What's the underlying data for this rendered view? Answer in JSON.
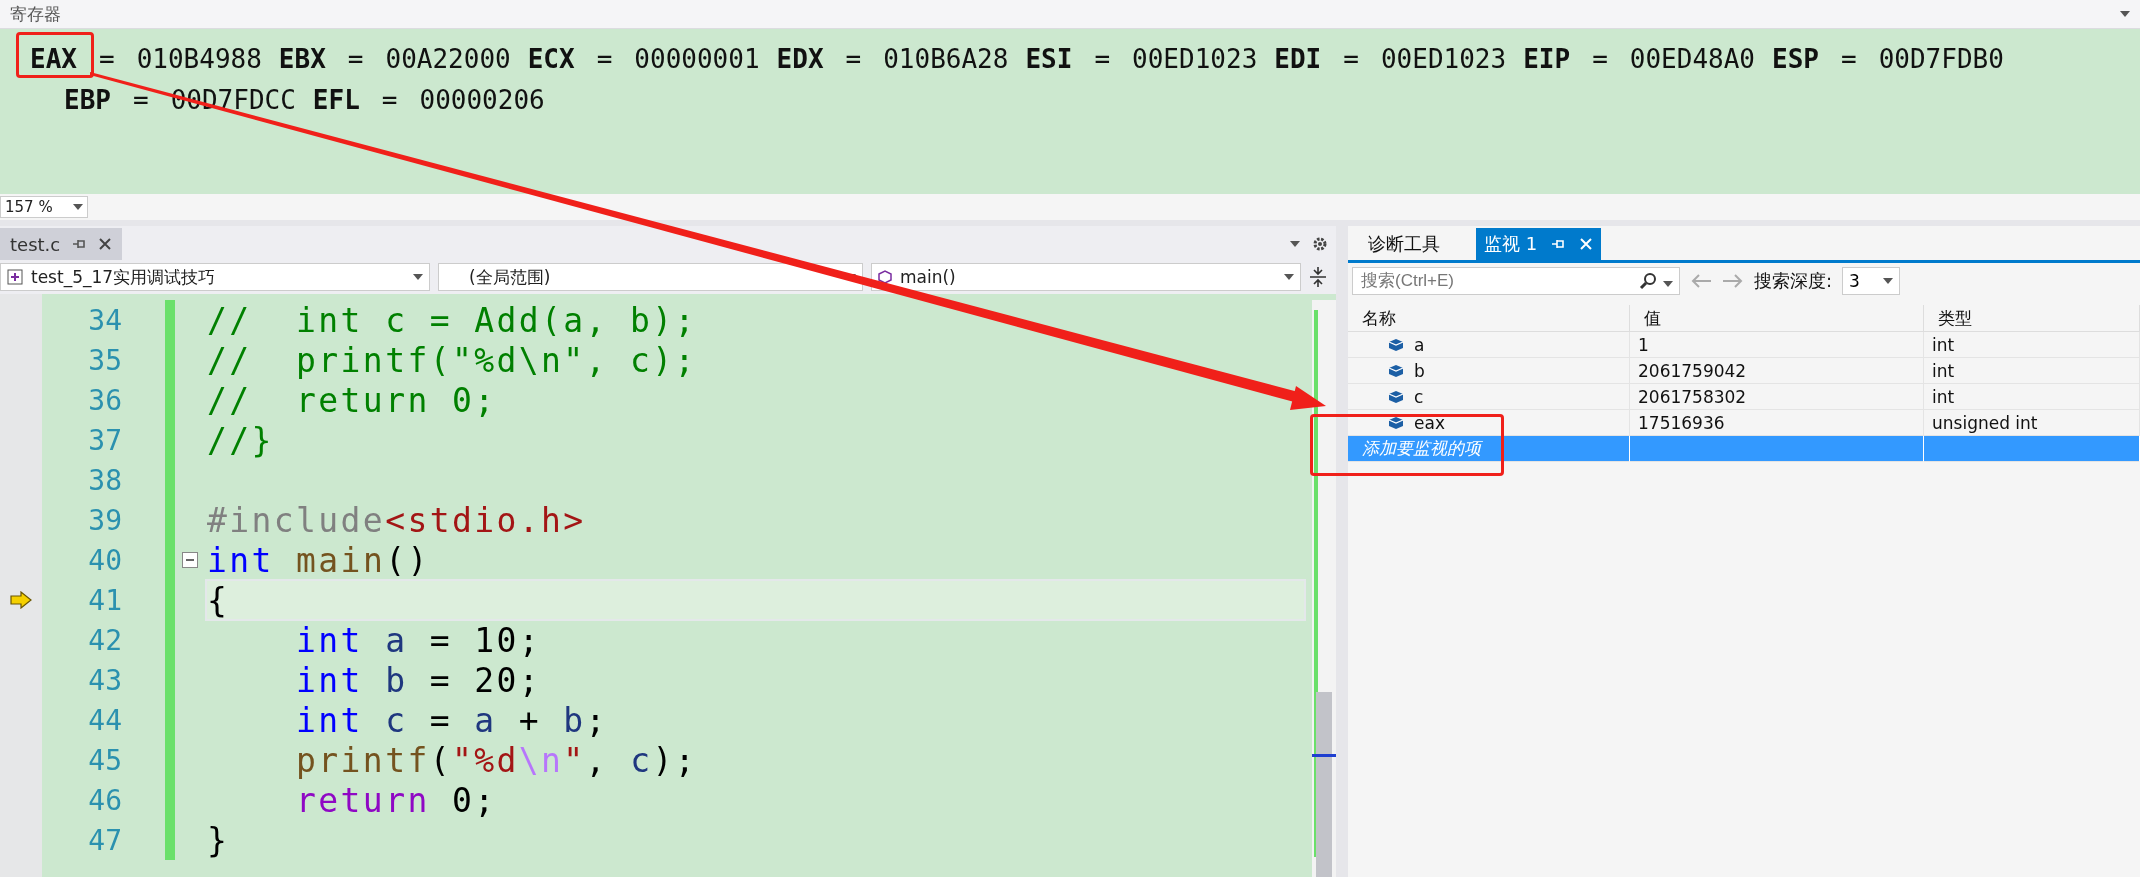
{
  "registers": {
    "title": "寄存器",
    "lines": [
      [
        {
          "name": "EAX",
          "sep": "=",
          "value": "010B4988"
        },
        {
          "name": "EBX",
          "sep": "=",
          "value": "00A22000"
        },
        {
          "name": "ECX",
          "sep": "=",
          "value": "00000001"
        },
        {
          "name": "EDX",
          "sep": "=",
          "value": "010B6A28"
        },
        {
          "name": "ESI",
          "sep": "=",
          "value": "00ED1023"
        },
        {
          "name": "EDI",
          "sep": "=",
          "value": "00ED1023"
        },
        {
          "name": "EIP",
          "sep": "=",
          "value": "00ED48A0"
        },
        {
          "name": "ESP",
          "sep": "=",
          "value": "00D7FDB0"
        }
      ],
      [
        {
          "name": "EBP",
          "sep": "=",
          "value": "00D7FDCC"
        },
        {
          "name": "EFL",
          "sep": "=",
          "value": "00000206"
        }
      ]
    ],
    "zoom": "157 %"
  },
  "editor": {
    "tab": "test.c",
    "project": "test_5_17实用调试技巧",
    "scope": "(全局范围)",
    "function": "main()",
    "lines": [
      {
        "number": "34",
        "current": false,
        "fold": false,
        "tokens": [
          {
            "kind": "comment",
            "text": "//  int c = Add(a, b);"
          }
        ]
      },
      {
        "number": "35",
        "current": false,
        "fold": false,
        "tokens": [
          {
            "kind": "comment",
            "text": "//  printf(\"%d\\n\", c);"
          }
        ]
      },
      {
        "number": "36",
        "current": false,
        "fold": false,
        "tokens": [
          {
            "kind": "comment",
            "text": "//  return 0;"
          }
        ]
      },
      {
        "number": "37",
        "current": false,
        "fold": false,
        "tokens": [
          {
            "kind": "comment",
            "text": "//}"
          }
        ]
      },
      {
        "number": "38",
        "current": false,
        "fold": false
      },
      {
        "number": "39",
        "current": false,
        "fold": false,
        "tokens": [
          {
            "kind": "preproc",
            "text": "#include"
          },
          {
            "kind": "string",
            "text": "<stdio.h>"
          }
        ]
      },
      {
        "number": "40",
        "current": false,
        "fold": true,
        "tokens": [
          {
            "kind": "keyword",
            "text": "int"
          },
          {
            "kind": "func",
            "text": " main"
          },
          {
            "kind": "plain",
            "text": "()"
          }
        ]
      },
      {
        "number": "41",
        "current": true,
        "fold": false,
        "tokens": [
          {
            "kind": "plain",
            "text": "{"
          }
        ]
      },
      {
        "number": "42",
        "current": false,
        "fold": false,
        "tokens": [
          {
            "kind": "keyword",
            "text": "    int"
          },
          {
            "kind": "ident",
            "text": " a"
          },
          {
            "kind": "plain",
            "text": " = 10;"
          }
        ]
      },
      {
        "number": "43",
        "current": false,
        "fold": false,
        "tokens": [
          {
            "kind": "keyword",
            "text": "    int"
          },
          {
            "kind": "ident",
            "text": " b"
          },
          {
            "kind": "plain",
            "text": " = 20;"
          }
        ]
      },
      {
        "number": "44",
        "current": false,
        "fold": false,
        "tokens": [
          {
            "kind": "keyword",
            "text": "    int"
          },
          {
            "kind": "ident",
            "text": " c"
          },
          {
            "kind": "plain",
            "text": " = "
          },
          {
            "kind": "ident",
            "text": "a"
          },
          {
            "kind": "plain",
            "text": " + "
          },
          {
            "kind": "ident",
            "text": "b"
          },
          {
            "kind": "plain",
            "text": ";"
          }
        ]
      },
      {
        "number": "45",
        "current": false,
        "fold": false,
        "tokens": [
          {
            "kind": "func",
            "text": "    printf"
          },
          {
            "kind": "plain",
            "text": "("
          },
          {
            "kind": "string",
            "text": "\"%d"
          },
          {
            "kind": "escape",
            "text": "\\n"
          },
          {
            "kind": "string",
            "text": "\""
          },
          {
            "kind": "plain",
            "text": ", "
          },
          {
            "kind": "ident",
            "text": "c"
          },
          {
            "kind": "plain",
            "text": ");"
          }
        ]
      },
      {
        "number": "46",
        "current": false,
        "fold": false,
        "tokens": [
          {
            "kind": "control",
            "text": "    return"
          },
          {
            "kind": "plain",
            "text": " 0;"
          }
        ]
      },
      {
        "number": "47",
        "current": false,
        "fold": false,
        "tokens": [
          {
            "kind": "plain",
            "text": "}"
          }
        ]
      }
    ]
  },
  "watch": {
    "tabs": [
      {
        "label": "诊断工具",
        "selected": false
      },
      {
        "label": "监视 1",
        "selected": true
      }
    ],
    "search": {
      "placeholder": "搜索(Ctrl+E)"
    },
    "depth_label": "搜索深度:",
    "depth": "3",
    "columns": [
      "名称",
      "值",
      "类型"
    ],
    "rows": [
      {
        "name": "a",
        "value": "1",
        "type": "int",
        "selected": false
      },
      {
        "name": "b",
        "value": "2061759042",
        "type": "int",
        "selected": false
      },
      {
        "name": "c",
        "value": "2061758302",
        "type": "int",
        "selected": false
      },
      {
        "name": "eax",
        "value": "17516936",
        "type": "unsigned int",
        "selected": false
      }
    ],
    "add_item": {
      "label": "添加要监视的项",
      "selected": true
    }
  }
}
